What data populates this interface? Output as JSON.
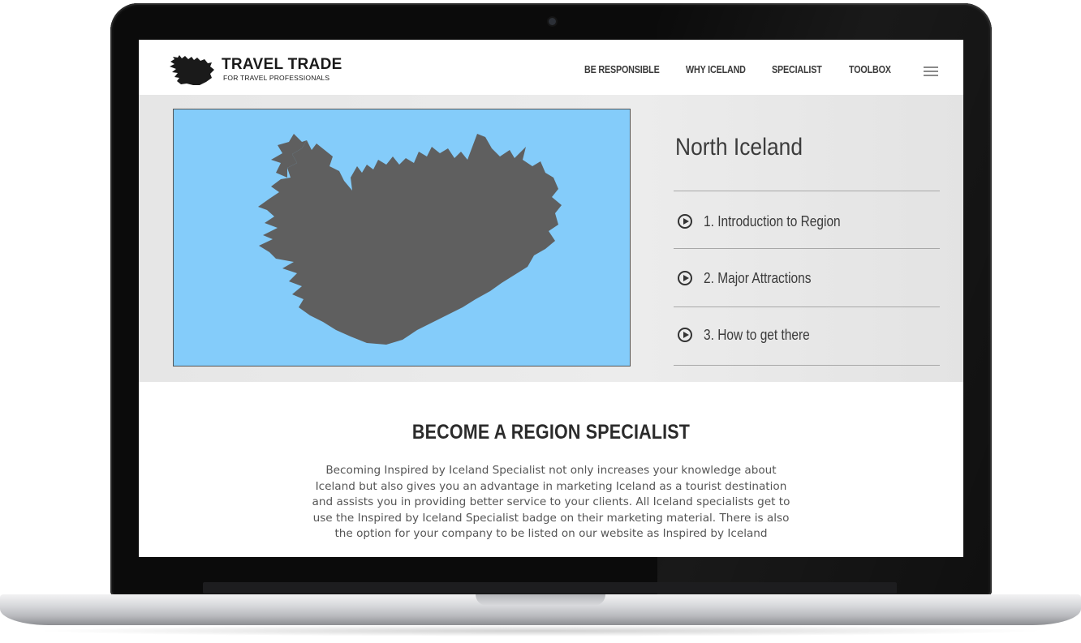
{
  "brand": {
    "title": "TRAVEL TRADE",
    "subtitle": "FOR TRAVEL PROFESSIONALS",
    "logo_icon": "iceland-silhouette-icon"
  },
  "nav": {
    "items": [
      "BE RESPONSIBLE",
      "WHY ICELAND",
      "SPECIALIST",
      "TOOLBOX"
    ],
    "menu_icon": "hamburger-menu-icon"
  },
  "hero": {
    "region_title": "North Iceland",
    "map_colors": {
      "sea": "#84ccfa",
      "land": "#5f5f5f"
    },
    "links": [
      {
        "label": "1. Introduction to Region",
        "icon": "play-circle-icon"
      },
      {
        "label": "2. Major Attractions",
        "icon": "play-circle-icon"
      },
      {
        "label": "3. How to get there",
        "icon": "play-circle-icon"
      }
    ]
  },
  "section": {
    "heading": "BECOME A REGION SPECIALIST",
    "lines": [
      "Becoming Inspired by Iceland Specialist not only increases your knowledge about",
      "Iceland but also gives you an advantage in marketing Iceland as a tourist destination",
      "and assists you in providing better service to your clients. All Iceland specialists get to",
      "use the Inspired by Iceland Specialist badge on their marketing material. There is also",
      "the option for your company to be listed on our website as Inspired by Iceland"
    ]
  }
}
